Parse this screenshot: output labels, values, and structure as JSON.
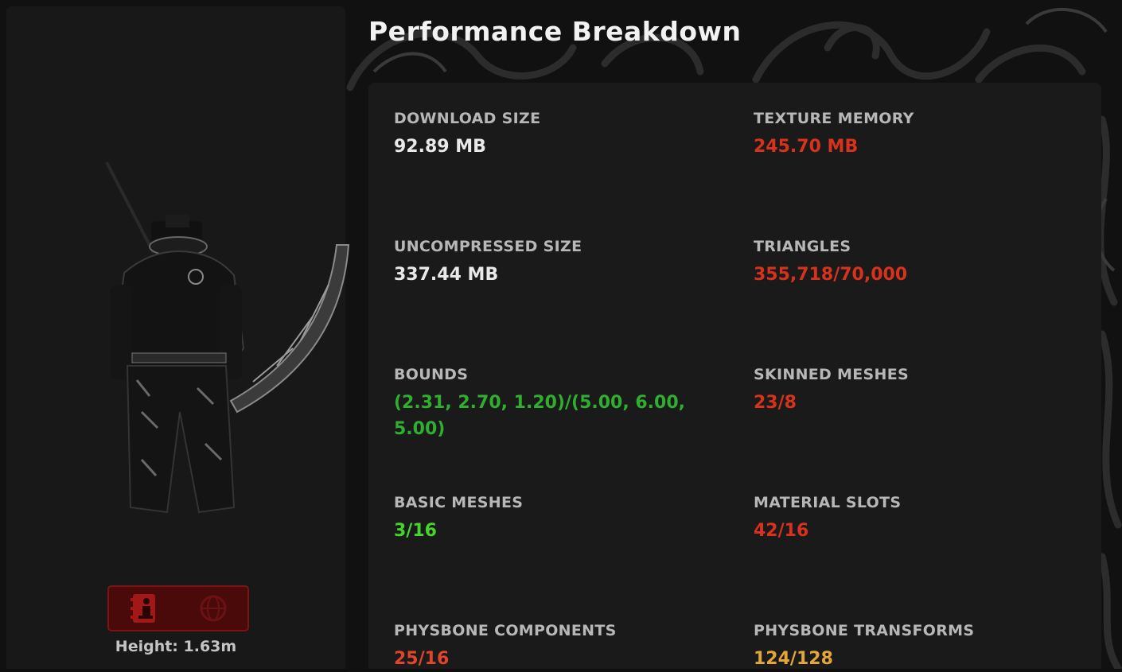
{
  "title": "Performance Breakdown",
  "avatar": {
    "height_text": "Height: 1.63m"
  },
  "view_toggle": [
    {
      "icon": "avatar-info-icon",
      "active": true
    },
    {
      "icon": "globe-icon",
      "active": false
    }
  ],
  "colors": {
    "white": "#e9e9e9",
    "red": "#d8321c",
    "green": "#2fae2f",
    "bright_green": "#45d42b",
    "orange_red": "#e0452a",
    "amber": "#e3a638"
  },
  "stats": [
    {
      "label": "DOWNLOAD SIZE",
      "value": "92.89 MB",
      "color": "#e9e9e9"
    },
    {
      "label": "TEXTURE MEMORY",
      "value": "245.70 MB",
      "color": "#d8321c"
    },
    {
      "label": "UNCOMPRESSED SIZE",
      "value": "337.44 MB",
      "color": "#e9e9e9"
    },
    {
      "label": "TRIANGLES",
      "value": "355,718/70,000",
      "color": "#d8321c"
    },
    {
      "label": "BOUNDS",
      "value": "(2.31, 2.70, 1.20)/(5.00, 6.00, 5.00)",
      "color": "#2fae2f"
    },
    {
      "label": "SKINNED MESHES",
      "value": "23/8",
      "color": "#d8321c"
    },
    {
      "label": "BASIC MESHES",
      "value": "3/16",
      "color": "#45d42b"
    },
    {
      "label": "MATERIAL SLOTS",
      "value": "42/16",
      "color": "#d8321c"
    },
    {
      "label": "PHYSBONE COMPONENTS",
      "value": "25/16",
      "color": "#e0452a"
    },
    {
      "label": "PHYSBONE TRANSFORMS",
      "value": "124/128",
      "color": "#e3a638"
    }
  ]
}
